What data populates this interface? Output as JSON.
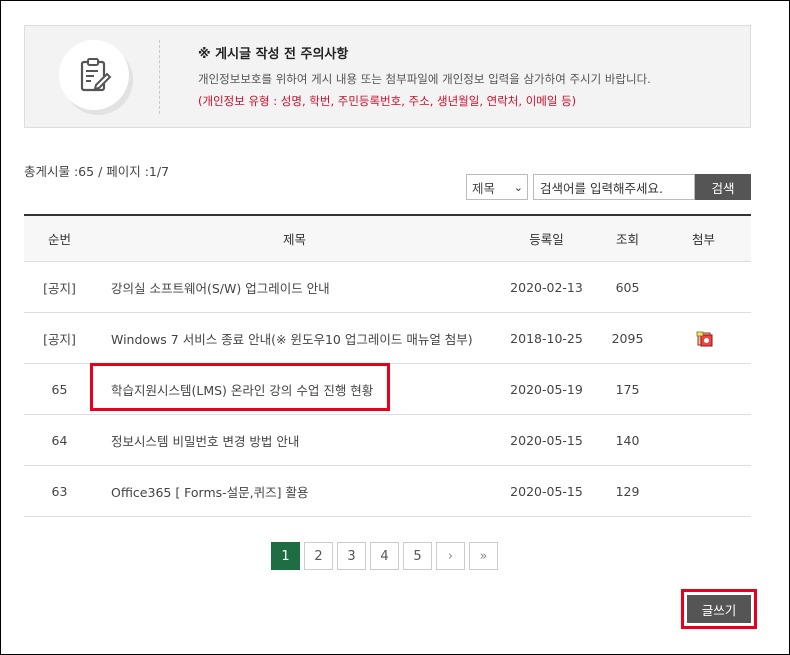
{
  "notice": {
    "icon": "clipboard-pen-icon",
    "title": "※ 게시글 작성 전 주의사항",
    "description": "개인정보보호를 위하여 게시 내용 또는 첨부파일에 개인정보 입력을 삼가하여 주시기 바랍니다.",
    "types": "(개인정보 유형 : 성명, 학번, 주민등록번호, 주소, 생년월일, 연락처, 이메일 등)"
  },
  "summary": "총게시물 :65 / 페이지 :1/7",
  "search": {
    "field_selected": "제목",
    "placeholder": "검색어를 입력해주세요.",
    "button": "검색"
  },
  "table": {
    "headers": {
      "no": "순번",
      "title": "제목",
      "date": "등록일",
      "views": "조회",
      "attach": "첨부"
    },
    "rows": [
      {
        "no": "[공지]",
        "title": "강의실 소프트웨어(S/W) 업그레이드 안내",
        "date": "2020-02-13",
        "views": "605",
        "attach": false
      },
      {
        "no": "[공지]",
        "title": "Windows 7 서비스 종료 안내(※ 윈도우10 업그레이드 매뉴얼 첨부)",
        "date": "2018-10-25",
        "views": "2095",
        "attach": true
      },
      {
        "no": "65",
        "title": "학습지원시스템(LMS) 온라인 강의 수업 진행 현황",
        "date": "2020-05-19",
        "views": "175",
        "attach": false
      },
      {
        "no": "64",
        "title": "정보시스템 비밀번호 변경 방법 안내",
        "date": "2020-05-15",
        "views": "140",
        "attach": false
      },
      {
        "no": "63",
        "title": "Office365 [ Forms-설문,퀴즈] 활용",
        "date": "2020-05-15",
        "views": "129",
        "attach": false
      }
    ]
  },
  "pagination": {
    "pages": [
      "1",
      "2",
      "3",
      "4",
      "5"
    ],
    "active": "1",
    "next": "›",
    "last": "»"
  },
  "write_button": "글쓰기",
  "colors": {
    "accent_green": "#1f6e43",
    "highlight_red": "#e8001c",
    "notice_red": "#c8102e",
    "button_gray": "#555555"
  }
}
